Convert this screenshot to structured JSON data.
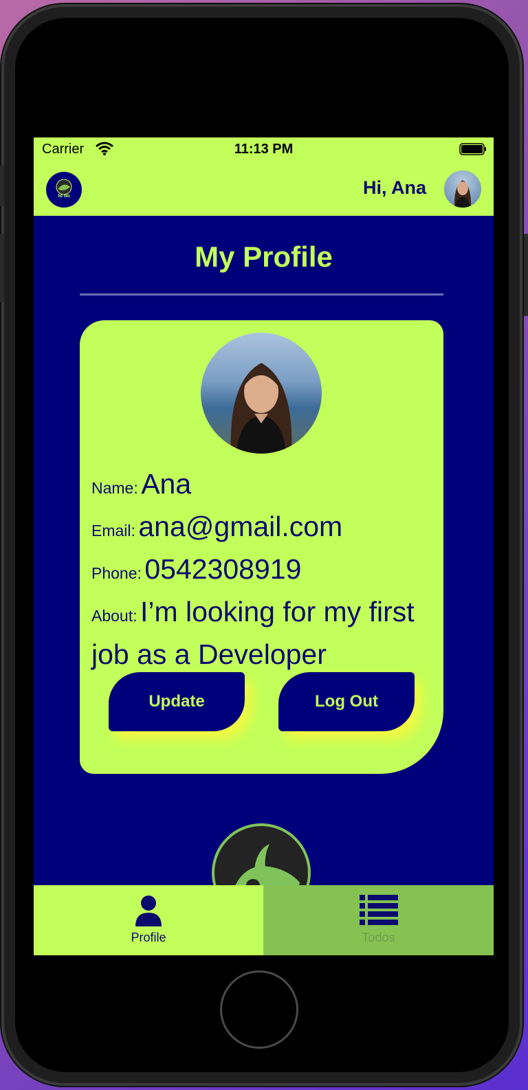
{
  "status_bar": {
    "carrier": "Carrier",
    "time": "11:13 PM"
  },
  "header": {
    "logo_text": "to do",
    "greeting": "Hi, Ana"
  },
  "page": {
    "title": "My Profile"
  },
  "profile": {
    "name_label": "Name:",
    "name": "Ana",
    "email_label": "Email:",
    "email": "ana@gmail.com",
    "phone_label": "Phone:",
    "phone": "0542308919",
    "about_label": "About:",
    "about": "I’m looking for my first job as a Developer"
  },
  "buttons": {
    "update": "Update",
    "logout": "Log Out"
  },
  "tabs": [
    {
      "label": "Profile",
      "icon": "person-icon"
    },
    {
      "label": "Todos",
      "icon": "list-icon"
    }
  ],
  "colors": {
    "lime": "#c2ff5a",
    "navy": "#00007a",
    "tab_inactive": "#86c252"
  }
}
